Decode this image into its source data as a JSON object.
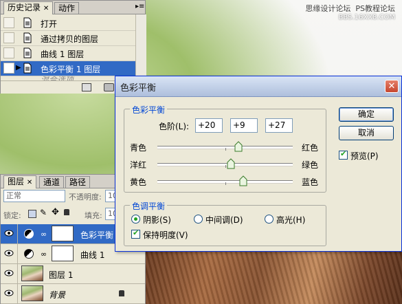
{
  "watermark": {
    "line1": "思缘设计论坛",
    "line2": "PS教程论坛",
    "line3": "BBS.16XX8.COM"
  },
  "history_panel": {
    "tabs": [
      "历史记录",
      "动作"
    ],
    "items": [
      {
        "label": "打开",
        "selected": false
      },
      {
        "label": "通过拷贝的图层",
        "selected": false
      },
      {
        "label": "曲线 1 图层",
        "selected": false
      },
      {
        "label": "色彩平衡 1 图层",
        "selected": true
      },
      {
        "label": "混合选项",
        "selected": false
      }
    ]
  },
  "layers_panel": {
    "tabs": [
      "图层",
      "通道",
      "路径"
    ],
    "blend_mode": "正常",
    "opacity_label": "不透明度:",
    "opacity_value": "10",
    "lock_label": "锁定:",
    "fill_label": "填充:",
    "fill_value": "10",
    "layers": [
      {
        "name": "色彩平衡",
        "type": "adjustment",
        "selected": true
      },
      {
        "name": "曲线 1",
        "type": "adjustment",
        "selected": false
      },
      {
        "name": "图层 1",
        "type": "image",
        "selected": false
      },
      {
        "name": "背景",
        "type": "image",
        "selected": false,
        "locked": true
      }
    ]
  },
  "dialog": {
    "title": "色彩平衡",
    "color_balance": {
      "group_title": "色彩平衡",
      "levels_label": "色阶(L):",
      "levels": [
        "+20",
        "+9",
        "+27"
      ],
      "sliders": [
        {
          "left": "青色",
          "right": "红色",
          "value": 20
        },
        {
          "left": "洋红",
          "right": "绿色",
          "value": 9
        },
        {
          "left": "黄色",
          "right": "蓝色",
          "value": 27
        }
      ]
    },
    "tone_balance": {
      "group_title": "色调平衡",
      "options": [
        "阴影(S)",
        "中间调(D)",
        "高光(H)"
      ],
      "selected": "阴影(S)",
      "preserve_luminosity": "保持明度(V)",
      "preserve_checked": true
    },
    "buttons": {
      "ok": "确定",
      "cancel": "取消"
    },
    "preview_label": "预览(P)",
    "preview_checked": true,
    "close_glyph": "✕"
  }
}
